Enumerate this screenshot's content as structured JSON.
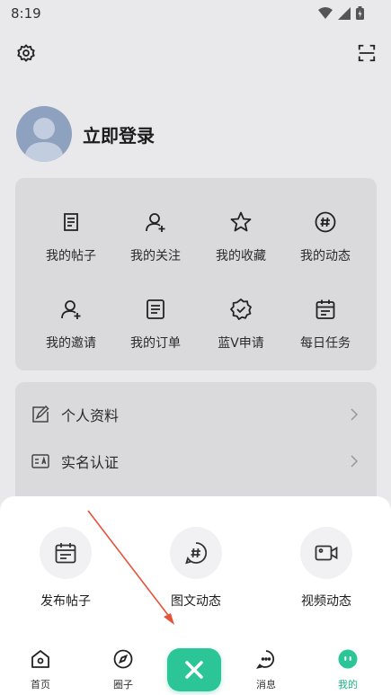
{
  "status_bar": {
    "time": "8:19"
  },
  "profile": {
    "login_label": "立即登录"
  },
  "grid": [
    {
      "label": "我的帖子",
      "icon": "post-icon"
    },
    {
      "label": "我的关注",
      "icon": "follow-user-icon"
    },
    {
      "label": "我的收藏",
      "icon": "star-icon"
    },
    {
      "label": "我的动态",
      "icon": "hash-icon"
    },
    {
      "label": "我的邀请",
      "icon": "invite-user-icon"
    },
    {
      "label": "我的订单",
      "icon": "order-icon"
    },
    {
      "label": "蓝V申请",
      "icon": "verified-badge-icon"
    },
    {
      "label": "每日任务",
      "icon": "calendar-task-icon"
    }
  ],
  "list": [
    {
      "label": "个人资料",
      "icon": "edit-profile-icon"
    },
    {
      "label": "实名认证",
      "icon": "id-card-icon"
    }
  ],
  "sheet": {
    "actions": [
      {
        "label": "发布帖子",
        "icon": "calendar-post-icon"
      },
      {
        "label": "图文动态",
        "icon": "hash-chat-icon"
      },
      {
        "label": "视频动态",
        "icon": "video-icon"
      }
    ]
  },
  "tabbar": {
    "tabs": [
      {
        "label": "首页",
        "icon": "home-icon"
      },
      {
        "label": "圈子",
        "icon": "compass-icon"
      },
      {
        "label": "消息",
        "icon": "message-icon"
      },
      {
        "label": "我的",
        "icon": "me-icon",
        "active": true
      }
    ]
  },
  "colors": {
    "accent": "#2bc597",
    "active_tab": "#1bb584",
    "arrow": "#e5533a"
  }
}
